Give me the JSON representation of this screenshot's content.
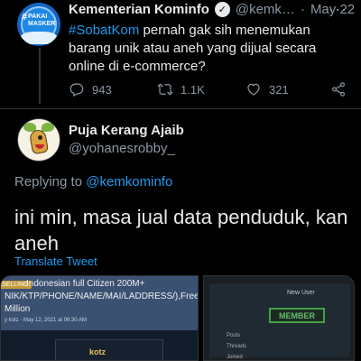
{
  "parent_tweet": {
    "avatar_text": "PAKAI MASKER",
    "avatar_hash": "#",
    "name": "Kementerian Kominfo",
    "handle": "@kemk…",
    "dot": "·",
    "date": "May 22",
    "hashtag": "#SobatKom",
    "text": " pernah gak sih menemukan barang unik atau aneh yang dijual secara online di e-commerce?",
    "replies": "943",
    "retweets": "1.1K",
    "likes": "321"
  },
  "main_tweet": {
    "name": "Puja Kerang Ajaib",
    "handle": "@yohanesrobby_",
    "replying_prefix": "Replying to ",
    "replying_to": "@kemkominfo",
    "text": "ini min, masa jual data penduduk, kan aneh",
    "translate_label": "Translate Tweet"
  },
  "media": {
    "left": {
      "tag": "SELLING",
      "title": "Indonesian full Citizen 200M+",
      "line1": "NIK/KTP/PHONE/NAME/MAI/LADDRESS/),Free",
      "line2": "Million",
      "meta": "y kotz - May 12, 2021 at 06:30 AM",
      "username": "kotz"
    },
    "right": {
      "new_user": "New User",
      "member_badge": "MEMBER",
      "stats": [
        "Posts",
        "Threads",
        "Joined"
      ]
    }
  },
  "colors": {
    "background": "#000000",
    "link": "#1d9bf0",
    "secondary_text": "#8b98a5",
    "primary_text": "#e7e9ea"
  }
}
